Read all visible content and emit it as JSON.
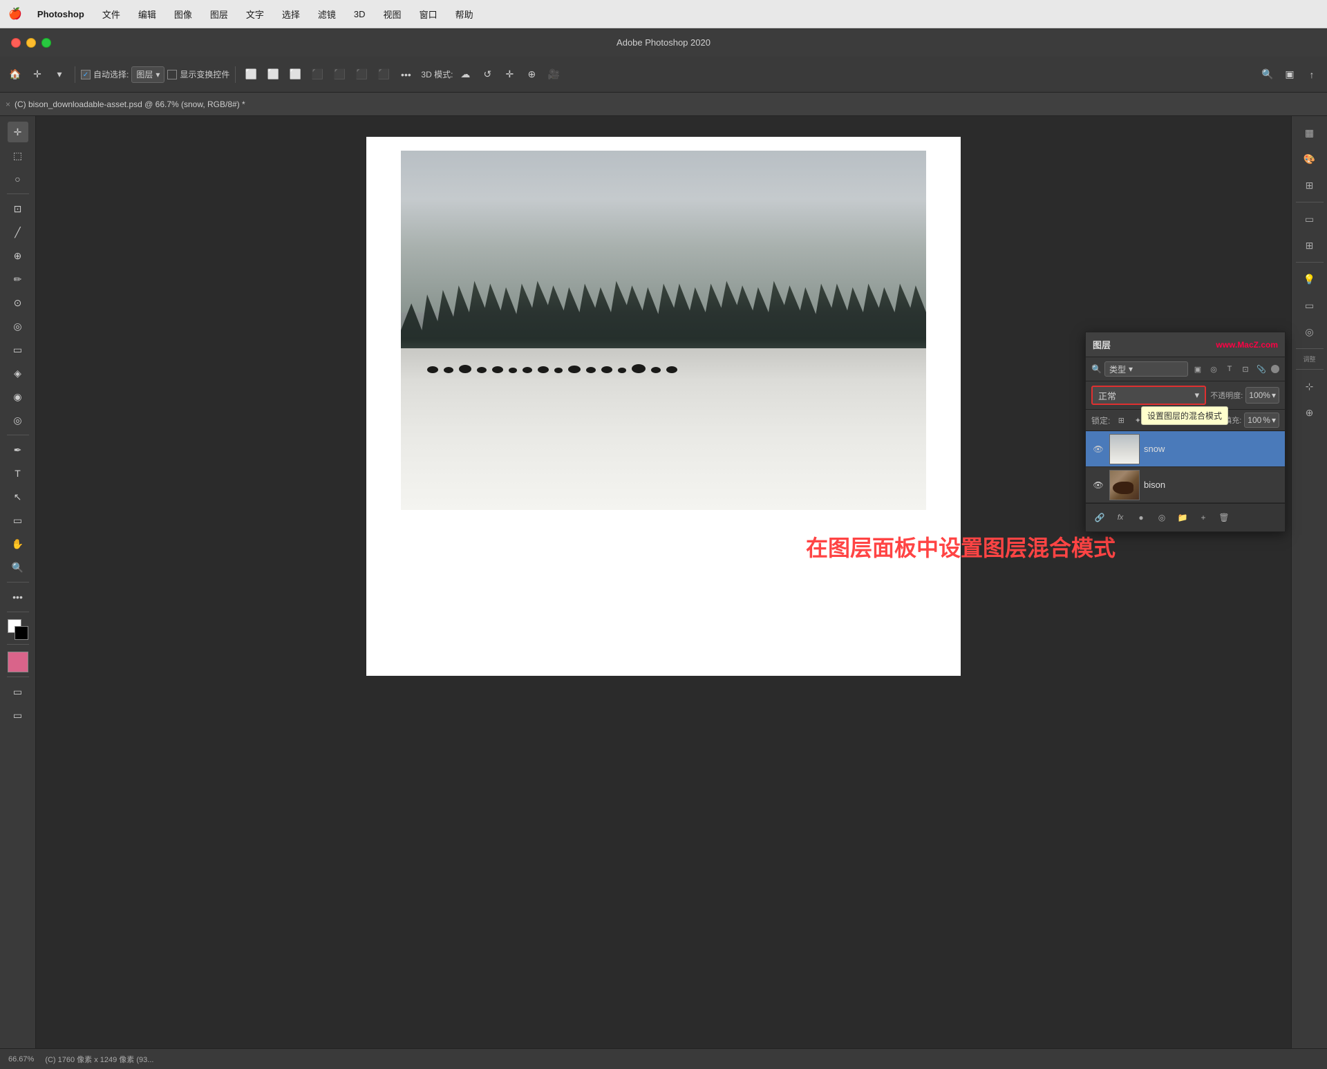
{
  "menubar": {
    "apple": "🍎",
    "items": [
      "Photoshop",
      "文件",
      "编辑",
      "图像",
      "图层",
      "文字",
      "选择",
      "滤镜",
      "3D",
      "视图",
      "窗口",
      "帮助"
    ]
  },
  "titlebar": {
    "title": "Adobe Photoshop 2020"
  },
  "toolbar": {
    "auto_select_label": "自动选择:",
    "layer_dropdown": "图层",
    "show_transform": "显示变换控件",
    "mode_3d": "3D 模式:"
  },
  "tab": {
    "close": "×",
    "title": "(C) bison_downloadable-asset.psd @ 66.7% (snow, RGB/8#) *"
  },
  "layers_panel": {
    "title": "图层",
    "watermark": "www.MacZ.com",
    "filter_label": "类型",
    "blend_mode": "正常",
    "opacity_label": "不透明度:",
    "opacity_value": "100%",
    "lock_label": "锁定:",
    "fill_label": "填充:",
    "fill_value": "%",
    "tooltip": "设置图层的混合模式",
    "layers": [
      {
        "name": "snow",
        "visible": true,
        "active": true
      },
      {
        "name": "bison",
        "visible": true,
        "active": false
      }
    ],
    "footer_icons": [
      "🔗",
      "fx",
      "●",
      "◎",
      "📁",
      "+",
      "🗑"
    ]
  },
  "caption": {
    "text": "在图层面板中设置图层混合模式"
  },
  "statusbar": {
    "zoom": "66.67%",
    "info": "(C) 1760 像素 x 1249 像素 (93..."
  }
}
